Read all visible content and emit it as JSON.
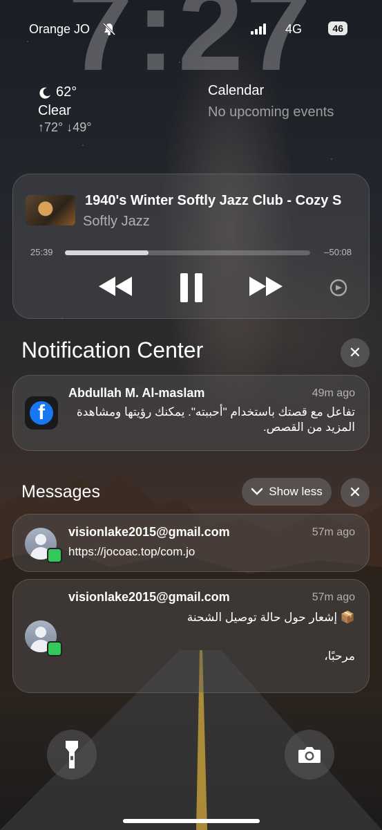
{
  "status": {
    "carrier": "Orange JO",
    "network": "4G",
    "battery": "46"
  },
  "clock": {
    "time": "7:27"
  },
  "weather": {
    "temp": "62°",
    "condition": "Clear",
    "range": "↑72° ↓49°"
  },
  "calendar": {
    "title": "Calendar",
    "subtitle": "No upcoming events"
  },
  "player": {
    "title": "1940's Winter Softly Jazz Club - Cozy S",
    "artist": "Softly Jazz",
    "elapsed": "25:39",
    "remaining": "–50:08",
    "progress": 0.34
  },
  "notification_center": {
    "title": "Notification Center",
    "facebook": {
      "sender": "Abdullah M. Al-maslam",
      "time": "49m ago",
      "body": "تفاعل مع قصتك باستخدام \"أحببته\". يمكنك رؤيتها ومشاهدة المزيد من القصص."
    }
  },
  "messages": {
    "title": "Messages",
    "show_less": "Show less",
    "items": [
      {
        "sender": "visionlake2015@gmail.com",
        "time": "57m ago",
        "body": "https://jocoac.top/com.jo"
      },
      {
        "sender": "visionlake2015@gmail.com",
        "time": "57m ago",
        "line1": "📦 إشعار حول حالة توصيل الشحنة",
        "line2": "مرحبًا،"
      }
    ]
  },
  "icons": {
    "bell": "bell-slash-icon",
    "signal": "signal-icon",
    "moon": "moon-icon",
    "rewind": "rewind-icon",
    "pause": "pause-icon",
    "forward": "fast-forward-icon",
    "airplay": "airplay-icon",
    "close": "close-icon",
    "chevron": "chevron-down-icon",
    "facebook": "facebook-icon",
    "contact": "contact-avatar-icon",
    "flashlight": "flashlight-icon",
    "camera": "camera-icon"
  },
  "colors": {
    "facebook": "#1877f2",
    "messages": "#34c759"
  }
}
